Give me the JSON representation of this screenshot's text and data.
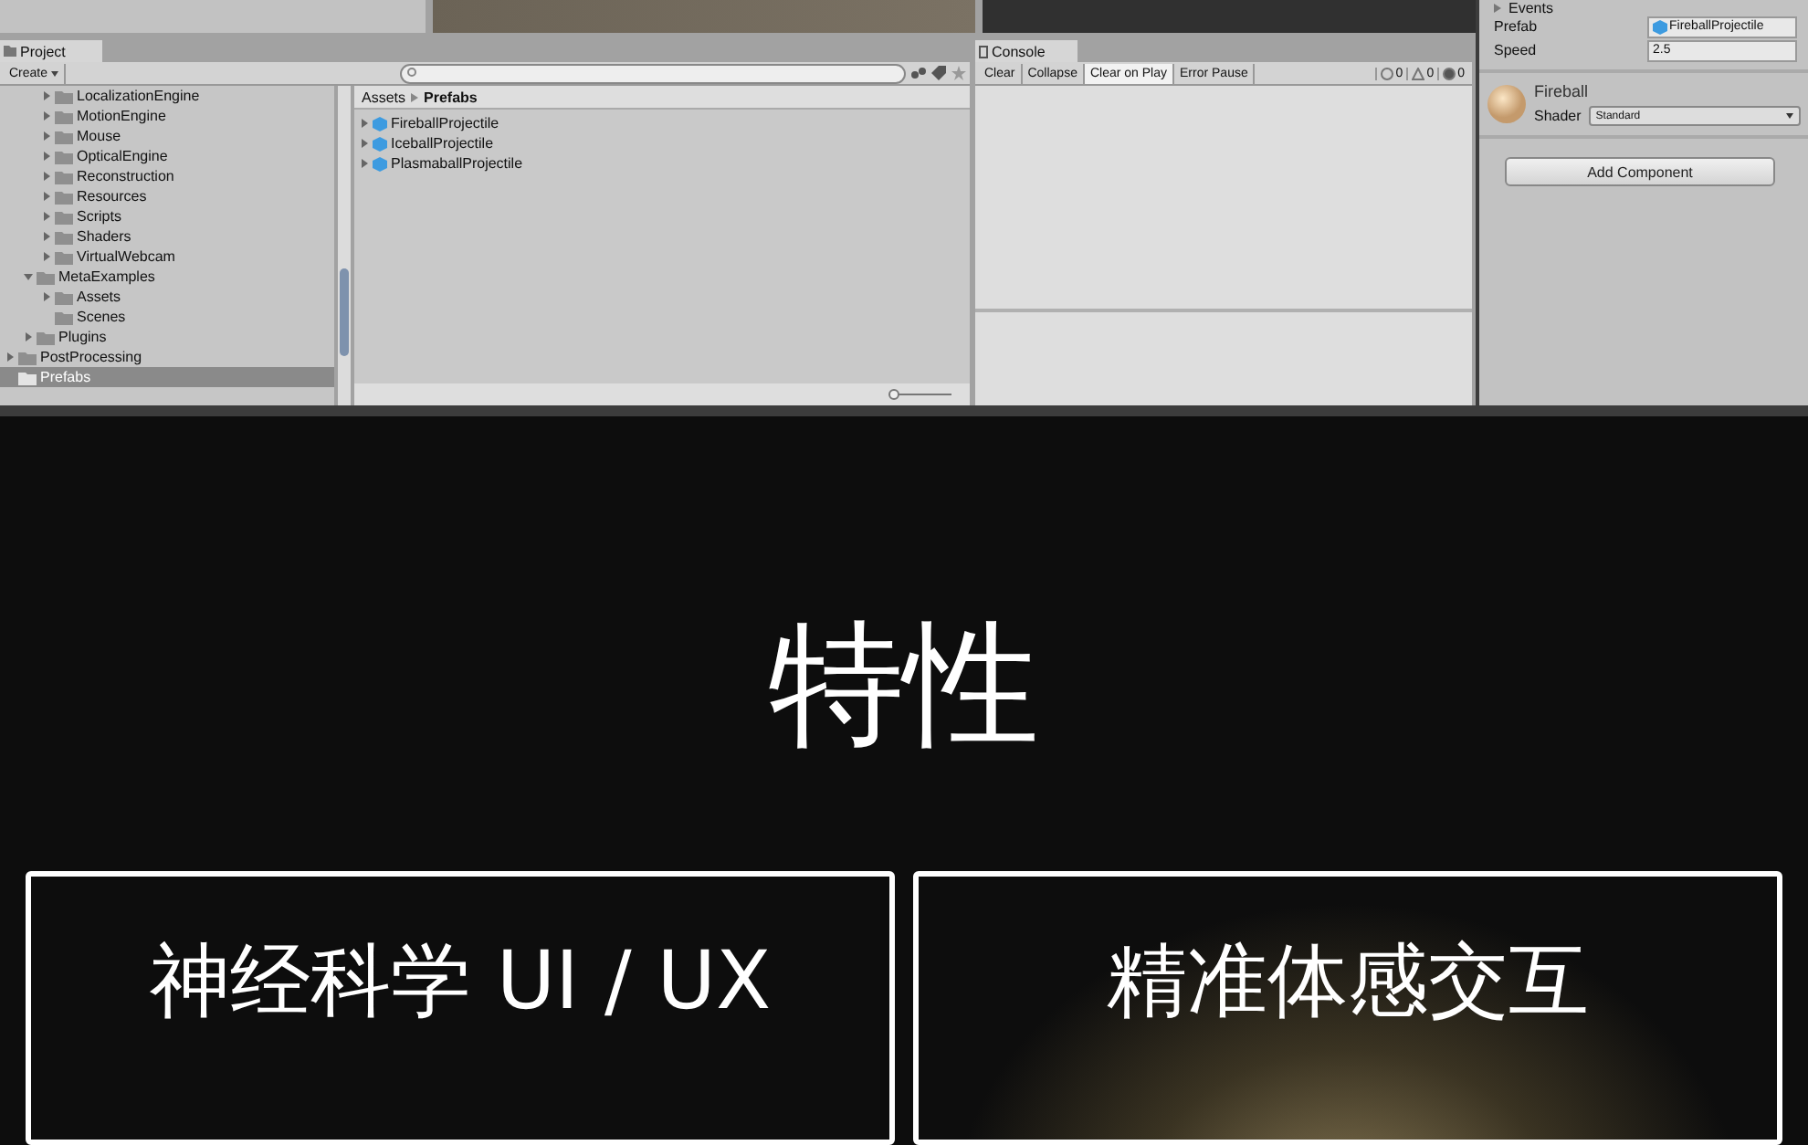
{
  "project": {
    "tab": "Project",
    "create_button": "Create",
    "tree": [
      {
        "children": [
          {
            "children": [
              {
                "label": "LocalizationEngine",
                "expanded": false,
                "selected": false
              },
              {
                "label": "MotionEngine",
                "expanded": false,
                "selected": false
              },
              {
                "label": "Mouse",
                "expanded": false,
                "selected": false
              },
              {
                "label": "OpticalEngine",
                "expanded": false,
                "selected": false
              },
              {
                "label": "Reconstruction",
                "expanded": false,
                "selected": false
              },
              {
                "label": "Resources",
                "expanded": false,
                "selected": false
              },
              {
                "label": "Scripts",
                "expanded": false,
                "selected": false
              },
              {
                "label": "Shaders",
                "expanded": false,
                "selected": false
              },
              {
                "label": "VirtualWebcam",
                "expanded": false,
                "selected": false
              }
            ]
          },
          {
            "label": "MetaExamples",
            "expanded": true,
            "selected": false,
            "children": [
              {
                "label": "Assets",
                "expanded": false,
                "selected": false
              },
              {
                "label": "Scenes",
                "selected": false
              }
            ]
          },
          {
            "label": "Plugins",
            "expanded": false,
            "selected": false
          }
        ]
      },
      {
        "label": "PostProcessing",
        "expanded": false,
        "selected": false
      },
      {
        "label": "Prefabs",
        "selected": true
      }
    ],
    "breadcrumb": [
      "Assets",
      "Prefabs"
    ],
    "assets": [
      "FireballProjectile",
      "IceballProjectile",
      "PlasmaballProjectile"
    ],
    "zoom_slider": {
      "level": 0.05
    }
  },
  "console": {
    "tab": "Console",
    "buttons": [
      {
        "label": "Clear",
        "selected": false
      },
      {
        "label": "Collapse",
        "selected": false
      },
      {
        "label": "Clear on Play",
        "selected": true
      },
      {
        "label": "Error Pause",
        "selected": false
      }
    ],
    "counts": [
      "0",
      "0",
      "0"
    ]
  },
  "inspector": {
    "events": "Events",
    "fields": [
      {
        "label": "Prefab",
        "value": "FireballProjectile",
        "kind": "object"
      },
      {
        "label": "Speed",
        "value": "2.5",
        "kind": "text"
      }
    ],
    "material": {
      "name": "Fireball",
      "shader_label": "Shader",
      "shader": "Standard"
    },
    "add_component": "Add Component"
  },
  "heading": "特性",
  "cards": [
    {
      "title": "神经科学 UI / UX",
      "glow": false
    },
    {
      "title": "精准体感交互",
      "glow": true
    }
  ]
}
